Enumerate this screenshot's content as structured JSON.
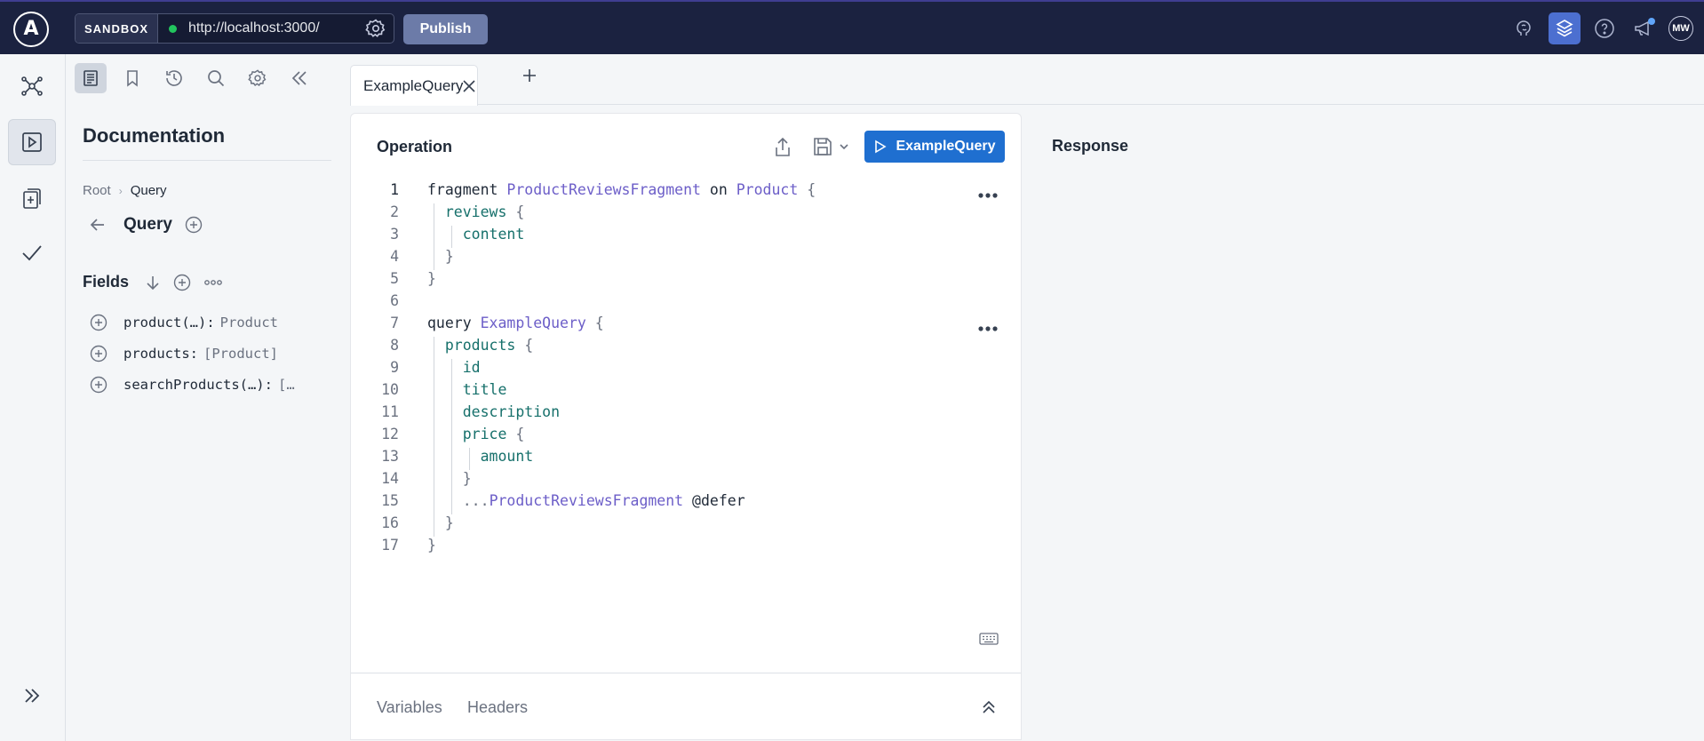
{
  "topbar": {
    "logo": "A",
    "env_label": "SANDBOX",
    "endpoint_url": "http://localhost:3000/",
    "publish_label": "Publish",
    "avatar_initials": "MW",
    "colors": {
      "background": "#1b2240",
      "accent": "#4c6fd0",
      "status_dot": "#22c55e"
    }
  },
  "rail": {
    "icons": [
      "schema-graph-icon",
      "explorer-play-icon",
      "checks-doc-icon",
      "checkmark-icon",
      "expand-double-chevron-icon"
    ],
    "active": "explorer-play-icon"
  },
  "doc_toolbar": {
    "icons": [
      "documentation-icon",
      "bookmark-icon",
      "history-icon",
      "search-icon",
      "settings-icon",
      "collapse-double-chevron-icon"
    ],
    "active": "documentation-icon"
  },
  "docs": {
    "title": "Documentation",
    "breadcrumb": [
      "Root",
      "Query"
    ],
    "current_type": "Query",
    "fields_label": "Fields",
    "fields": [
      {
        "name": "product(…):",
        "type": "Product"
      },
      {
        "name": "products:",
        "type": "[Product]"
      },
      {
        "name": "searchProducts(…):",
        "type": "[…"
      }
    ]
  },
  "tabs": [
    {
      "label": "ExampleQuery"
    }
  ],
  "editor": {
    "title": "Operation",
    "run_label": "ExampleQuery",
    "run_color": "#1f6fd0",
    "line_numbers": [
      "1",
      "2",
      "3",
      "4",
      "5",
      "6",
      "7",
      "8",
      "9",
      "10",
      "11",
      "12",
      "13",
      "14",
      "15",
      "16",
      "17"
    ],
    "bottom_tabs": [
      "Variables",
      "Headers"
    ],
    "code_tokens": {
      "l1_kw": "fragment",
      "l1_name": "ProductReviewsFragment",
      "l1_on": "on",
      "l1_type": "Product",
      "l1_brace": "{",
      "l2_field": "reviews",
      "l2_brace": "{",
      "l3_field": "content",
      "l4_brace": "}",
      "l5_brace": "}",
      "l7_kw": "query",
      "l7_name": "ExampleQuery",
      "l7_brace": "{",
      "l8_field": "products",
      "l8_brace": "{",
      "l9_field": "id",
      "l10_field": "title",
      "l11_field": "description",
      "l12_field": "price",
      "l12_brace": "{",
      "l13_field": "amount",
      "l14_brace": "}",
      "l15_spread": "...",
      "l15_name": "ProductReviewsFragment",
      "l15_directive": "@defer",
      "l16_brace": "}",
      "l17_brace": "}"
    }
  },
  "response": {
    "title": "Response"
  }
}
